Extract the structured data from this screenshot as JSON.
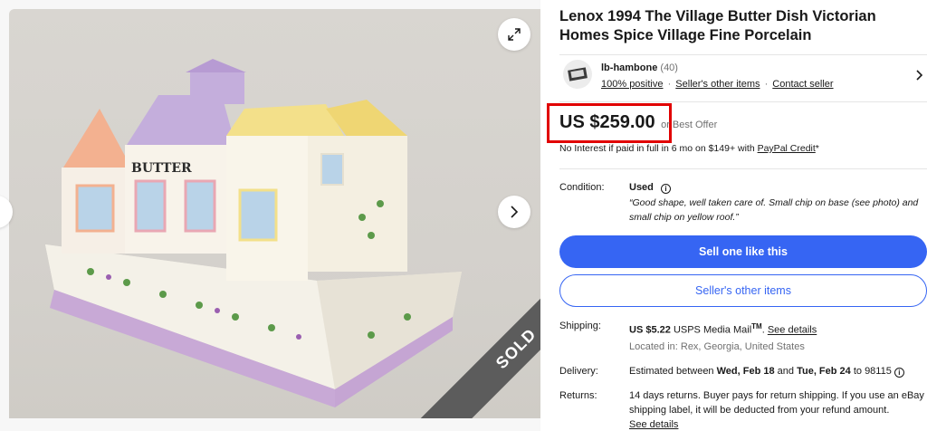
{
  "listing": {
    "title": "Lenox 1994 The Village Butter Dish Victorian Homes Spice Village Fine Porcelain",
    "sold_label": "SOLD",
    "photo_text": "BUTTER"
  },
  "seller": {
    "name": "lb-hambone",
    "count": "(40)",
    "positive": "100% positive",
    "sep": "·",
    "other_items": "Seller's other items",
    "contact": "Contact seller"
  },
  "price": {
    "amount": "US $259.00",
    "best_offer": "or Best Offer",
    "credit_text": "No Interest if paid in full in 6 mo on $149+ with ",
    "credit_link": "PayPal Credit",
    "credit_suffix": "*"
  },
  "condition": {
    "label": "Condition:",
    "value": "Used",
    "description": "“Good shape, well taken care of. Small chip on base (see photo) and small chip on yellow roof.”"
  },
  "buttons": {
    "sell_one": "Sell one like this",
    "sellers_other_items": "Seller's other items"
  },
  "shipping": {
    "label": "Shipping:",
    "cost": "US $5.22",
    "service": "USPS Media Mail",
    "tm": "TM",
    "period": ".",
    "details_link": "See details",
    "location": "Located in: Rex, Georgia, United States"
  },
  "delivery": {
    "label": "Delivery:",
    "prefix": "Estimated between ",
    "start": "Wed, Feb 18",
    "and": " and ",
    "end": "Tue, Feb 24",
    "to": " to 98115 "
  },
  "returns": {
    "label": "Returns:",
    "text": "14 days returns. Buyer pays for return shipping. If you use an eBay shipping label, it will be deducted from your refund amount.",
    "details_link": "See details"
  },
  "colors": {
    "accent": "#3665f3",
    "highlight_box": "#e10000",
    "sold_ribbon": "#5c5c5c"
  },
  "icons": {
    "expand": "expand-arrows-icon",
    "next": "chevron-right-icon",
    "prev": "chevron-left-icon",
    "seller_chevron": "chevron-right-icon",
    "info": "info-icon"
  }
}
